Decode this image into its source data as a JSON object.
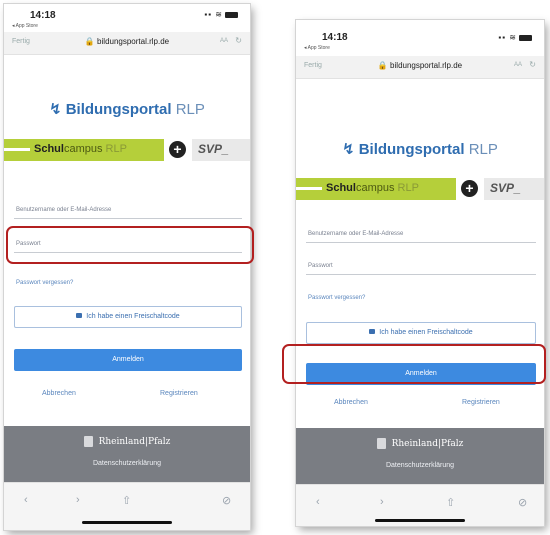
{
  "status": {
    "time": "14:18",
    "back_label": "◂ App Store"
  },
  "browser": {
    "done_label": "Fertig",
    "url": "🔒 bildungsportal.rlp.de",
    "text_size": "AA",
    "reload_icon": "↻"
  },
  "logo": {
    "mark": "↯",
    "name": "Bildungsportal",
    "region": "RLP"
  },
  "banner": {
    "bold": "Schul",
    "regular": "campus",
    "suffix": "RLP",
    "plus": "+",
    "partner": "SVP_"
  },
  "form": {
    "username_placeholder": "Benutzername oder E-Mail-Adresse",
    "password_placeholder": "Passwort",
    "forgot_link": "Passwort vergessen?",
    "freischaltcode_label": "Ich habe einen Freischaltcode",
    "login_label": "Anmelden",
    "cancel_label": "Abbrechen",
    "register_label": "Registrieren"
  },
  "footer": {
    "state_logo": "Rheinland|Pfalz",
    "privacy_link": "Datenschutzerklärung"
  },
  "toolbar": {
    "back": "‹",
    "forward": "›",
    "share": "⇧",
    "compass": "⊘"
  },
  "colors": {
    "accent": "#3d8ae0",
    "lime": "#b5cf3a",
    "highlight": "#b32020",
    "footer": "#7a7d83"
  }
}
